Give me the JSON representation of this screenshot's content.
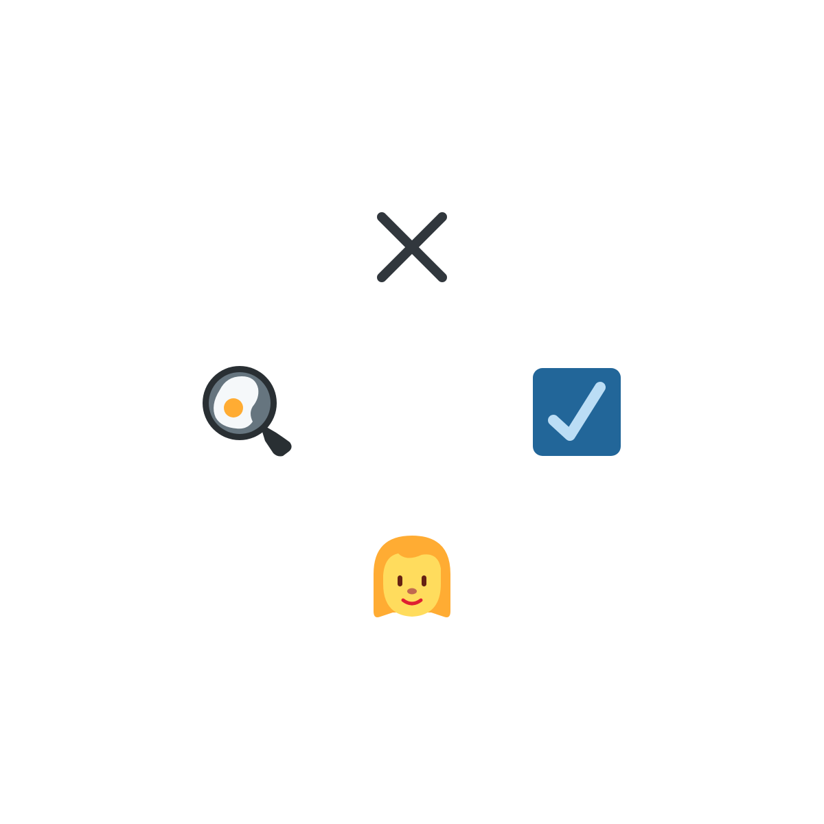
{
  "icons": [
    {
      "position": "top",
      "name": "cross-mark-icon",
      "color": "#31373D"
    },
    {
      "position": "left",
      "name": "frying-pan-egg-icon",
      "colors": {
        "pan": "#292F33",
        "pan_inner": "#66757F",
        "egg_white": "#F5F8FA",
        "yolk": "#FFAC33"
      }
    },
    {
      "position": "right",
      "name": "check-box-icon",
      "colors": {
        "box": "#226699",
        "check": "#BBDDF5"
      }
    },
    {
      "position": "bottom",
      "name": "woman-face-icon",
      "colors": {
        "hair": "#FFAC33",
        "skin": "#FFDC5D",
        "mouth": "#DF1F32",
        "eyes": "#662113",
        "nose": "#C1694F"
      }
    }
  ]
}
